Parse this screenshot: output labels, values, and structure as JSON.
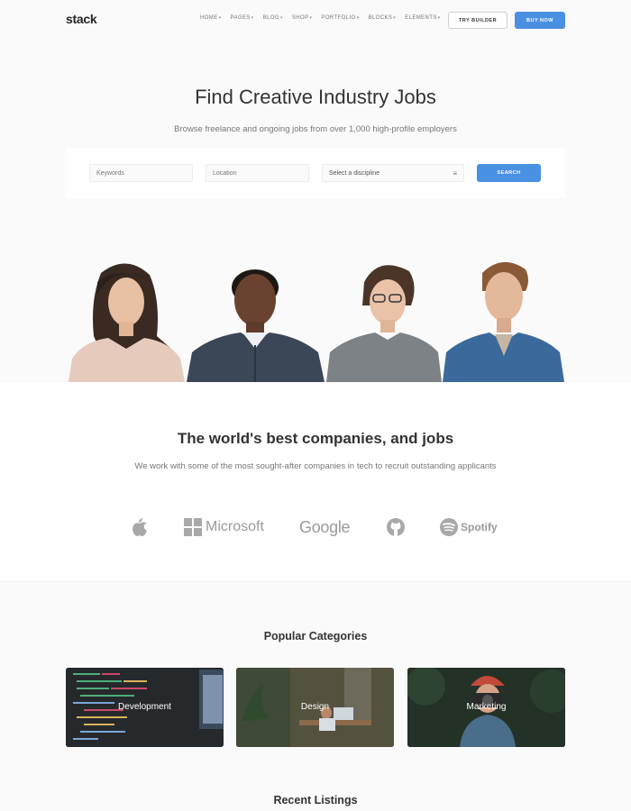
{
  "nav": {
    "logo": "stack",
    "menu": [
      "HOME",
      "PAGES",
      "BLOG",
      "SHOP",
      "PORTFOLIO",
      "BLOCKS",
      "ELEMENTS"
    ],
    "try_builder": "TRY BUILDER",
    "buy_now": "BUY NOW"
  },
  "hero": {
    "title": "Find Creative Industry Jobs",
    "subtitle": "Browse freelance and ongoing jobs from over 1,000 high-profile employers"
  },
  "search": {
    "keywords_placeholder": "Keywords",
    "location_placeholder": "Location",
    "discipline_selected": "Select a discipline",
    "button": "SEARCH"
  },
  "companies": {
    "title": "The world's best companies, and jobs",
    "subtitle": "We work with some of the most sought-after companies in tech to recruit outstanding applicants",
    "logos": [
      "apple-logo",
      "Microsoft",
      "Google",
      "github-logo",
      "Spotify"
    ]
  },
  "categories": {
    "title": "Popular Categories",
    "items": [
      "Development",
      "Design",
      "Marketing"
    ]
  },
  "recent": {
    "title": "Recent Listings"
  },
  "colors": {
    "accent": "#4a90e2",
    "text_dark": "#333333",
    "text_muted": "#777777",
    "background": "#fafafa"
  }
}
